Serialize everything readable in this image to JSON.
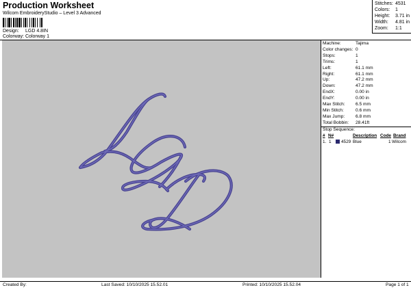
{
  "header": {
    "title": "Production Worksheet",
    "subtitle": "Wilcom EmbroideryStudio – Level 3 Advanced",
    "design_label": "Design:",
    "design_value": "LGD 4.8IN",
    "colorway_label": "Colorway:",
    "colorway_value": "Colorway 1"
  },
  "stats": [
    {
      "label": "Stitches:",
      "value": "4531"
    },
    {
      "label": "Colors:",
      "value": "1"
    },
    {
      "label": "Height:",
      "value": "3.71 in"
    },
    {
      "label": "Width:",
      "value": "4.81 in"
    },
    {
      "label": "Zoom:",
      "value": "1:1"
    }
  ],
  "design_preview": {
    "letters": "LGD",
    "thread_color": "#4b4693",
    "thread_highlight": "#6f6bb8",
    "background": "#c3c3c3"
  },
  "machine_info": [
    {
      "label": "Machine:",
      "value": "Tajima"
    },
    {
      "label": "Color changes:",
      "value": "0"
    },
    {
      "label": "Stops:",
      "value": "1"
    },
    {
      "label": "Trims:",
      "value": "1"
    },
    {
      "label": "Left:",
      "value": "61.1 mm"
    },
    {
      "label": "Right:",
      "value": "61.1 mm"
    },
    {
      "label": "Up:",
      "value": "47.2 mm"
    },
    {
      "label": "Down:",
      "value": "47.2 mm"
    },
    {
      "label": "EndX:",
      "value": "0.00 in"
    },
    {
      "label": "EndY:",
      "value": "0.00 in"
    },
    {
      "label": "Max Stitch:",
      "value": "6.5 mm"
    },
    {
      "label": "Min Stitch:",
      "value": "0.6 mm"
    },
    {
      "label": "Max Jump:",
      "value": "6.8 mm"
    },
    {
      "label": "Total Bobbin:",
      "value": "28.41ft"
    }
  ],
  "stop_sequence": {
    "title": "Stop Sequence:",
    "columns": [
      "#",
      "N#",
      "",
      "Description",
      "Code",
      "Brand"
    ],
    "rows": [
      {
        "index": "1.",
        "n": "1",
        "color": "#2b2a6e",
        "stitches": "4529",
        "description": "Blue",
        "code": "1",
        "brand": "Wilcom"
      }
    ]
  },
  "footer": {
    "created_by": "Created By:",
    "last_saved": "Last Saved: 10/10/2025 15.52.01",
    "printed": "Printed: 10/10/2025 15.52.04",
    "page": "Page 1 of 1"
  }
}
